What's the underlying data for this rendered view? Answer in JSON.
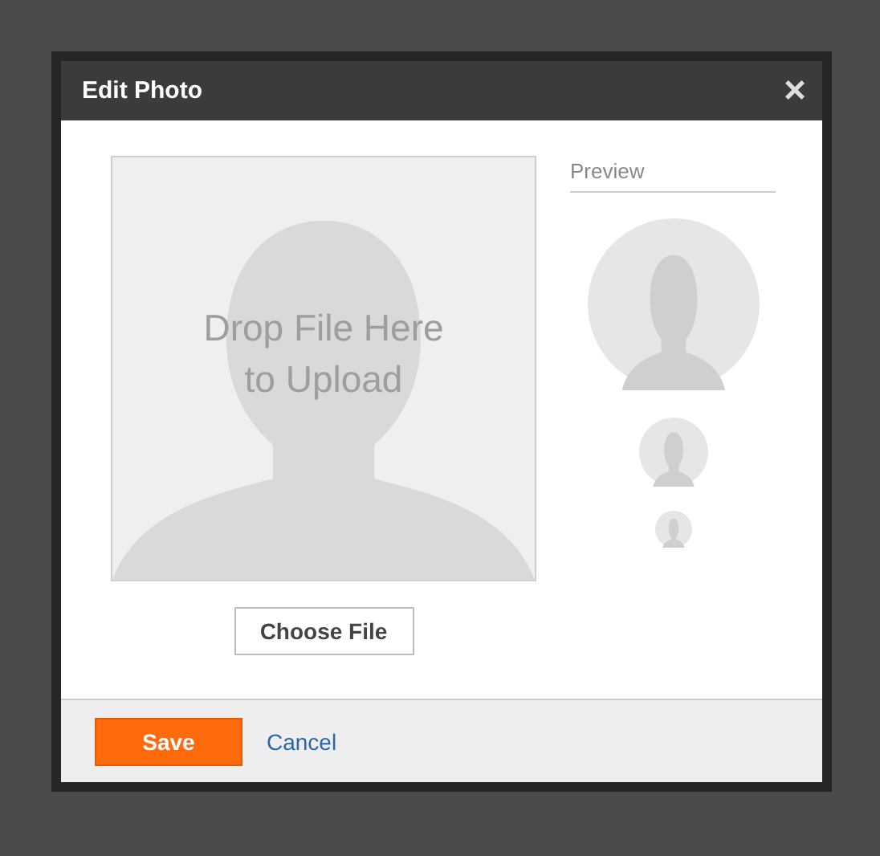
{
  "window": {
    "title": "Edit Photo",
    "close": "×"
  },
  "dropzone": {
    "text": "Drop File Here to Upload"
  },
  "choose_button": "Choose File",
  "preview": {
    "label": "Preview"
  },
  "footer": {
    "save": "Save",
    "cancel": "Cancel"
  }
}
